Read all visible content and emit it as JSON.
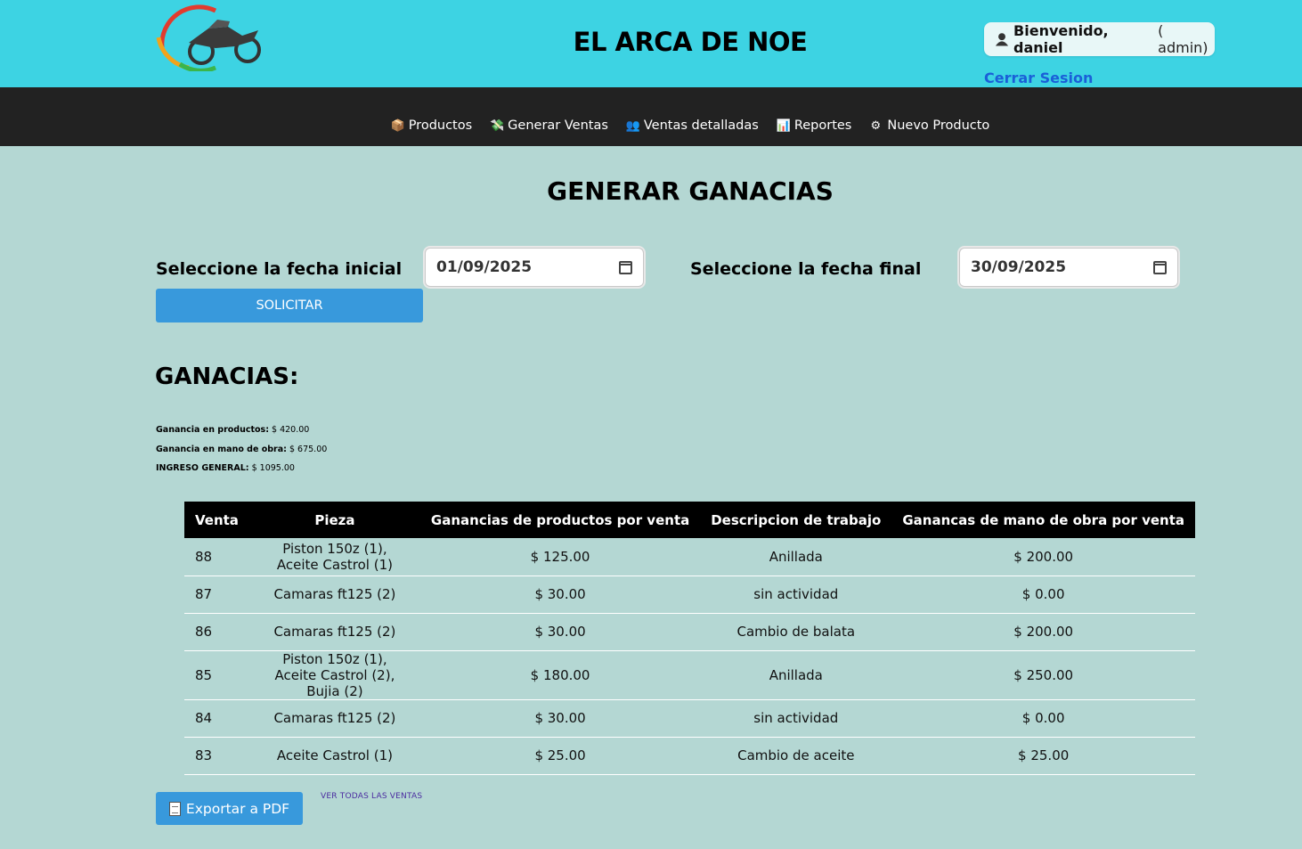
{
  "header": {
    "brand": "EL ARCA DE NOE",
    "logo_icon": "motorcycle-logo-icon",
    "user_icon": "user-icon",
    "greeting": "Bienvenido, daniel",
    "role": "( admin)",
    "logout": "Cerrar Sesion"
  },
  "nav": {
    "items": [
      {
        "label": "Productos",
        "icon": "box-icon",
        "glyph": "📦"
      },
      {
        "label": "Generar Ventas",
        "icon": "money-icon",
        "glyph": "💸"
      },
      {
        "label": "Ventas detalladas",
        "icon": "users-icon",
        "glyph": "👥"
      },
      {
        "label": "Reportes",
        "icon": "chart-icon",
        "glyph": "📊"
      },
      {
        "label": "Nuevo Producto",
        "icon": "gear-icon",
        "glyph": "⚙"
      }
    ]
  },
  "main": {
    "title": "GENERAR GANACIAS",
    "start_label": "Seleccione la fecha inicial",
    "start_value": "01/09/2025",
    "end_label": "Seleccione la fecha final",
    "end_value": "30/09/2025",
    "submit": "SOLICITAR",
    "ganancias_title": "GANACIAS:",
    "stats": [
      {
        "label": "Ganancia en productos:",
        "value": "$ 420.00"
      },
      {
        "label": "Ganancia en mano de obra:",
        "value": "$ 675.00"
      },
      {
        "label": "INGRESO GENERAL:",
        "value": "$ 1095.00"
      }
    ]
  },
  "table": {
    "headers": [
      "Venta",
      "Pieza",
      "Ganancias de productos por venta",
      "Descripcion de trabajo",
      "Ganancas de mano de obra por venta"
    ],
    "rows": [
      [
        "88",
        "Piston 150z (1), Aceite Castrol (1)",
        "$ 125.00",
        "Anillada",
        "$ 200.00"
      ],
      [
        "87",
        "Camaras ft125 (2)",
        "$ 30.00",
        "sin actividad",
        "$ 0.00"
      ],
      [
        "86",
        "Camaras ft125 (2)",
        "$ 30.00",
        "Cambio de balata",
        "$ 200.00"
      ],
      [
        "85",
        "Piston 150z (1), Aceite Castrol (2), Bujia (2)",
        "$ 180.00",
        "Anillada",
        "$ 250.00"
      ],
      [
        "84",
        "Camaras ft125 (2)",
        "$ 30.00",
        "sin actividad",
        "$ 0.00"
      ],
      [
        "83",
        "Aceite Castrol (1)",
        "$ 25.00",
        "Cambio de aceite",
        "$ 25.00"
      ]
    ]
  },
  "footer": {
    "export_label": "Exportar a PDF",
    "export_icon": "document-icon",
    "see_all": "VER TODAS LAS VENTAS"
  },
  "colors": {
    "header_bg": "#3dd3e3",
    "nav_bg": "#222222",
    "page_bg": "#b4d7d3",
    "button_bg": "#3899dc",
    "link": "#1a5fd8"
  }
}
